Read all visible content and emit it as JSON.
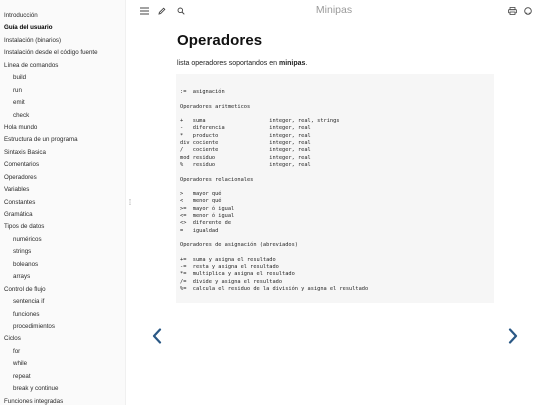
{
  "sidebar": {
    "items": [
      {
        "label": "Introducción",
        "level": 1,
        "active": false
      },
      {
        "label": "Guía del usuario",
        "level": 1,
        "active": true
      },
      {
        "label": "Instalación (binarios)",
        "level": 1,
        "active": false
      },
      {
        "label": "Instalación desde el código fuente",
        "level": 1,
        "active": false
      },
      {
        "label": "Línea de comandos",
        "level": 1,
        "active": false
      },
      {
        "label": "build",
        "level": 2,
        "active": false
      },
      {
        "label": "run",
        "level": 2,
        "active": false
      },
      {
        "label": "emit",
        "level": 2,
        "active": false
      },
      {
        "label": "check",
        "level": 2,
        "active": false
      },
      {
        "label": "Hola mundo",
        "level": 1,
        "active": false
      },
      {
        "label": "Estructura de un programa",
        "level": 1,
        "active": false
      },
      {
        "label": "Sintaxis Basica",
        "level": 1,
        "active": false
      },
      {
        "label": "Comentarios",
        "level": 1,
        "active": false
      },
      {
        "label": "Operadores",
        "level": 1,
        "active": false
      },
      {
        "label": "Variables",
        "level": 1,
        "active": false
      },
      {
        "label": "Constantes",
        "level": 1,
        "active": false
      },
      {
        "label": "Gramática",
        "level": 1,
        "active": false
      },
      {
        "label": "Tipos de datos",
        "level": 1,
        "active": false
      },
      {
        "label": "numéricos",
        "level": 2,
        "active": false
      },
      {
        "label": "strings",
        "level": 2,
        "active": false
      },
      {
        "label": "boleanos",
        "level": 2,
        "active": false
      },
      {
        "label": "arrays",
        "level": 2,
        "active": false
      },
      {
        "label": "Control de flujo",
        "level": 1,
        "active": false
      },
      {
        "label": "sentencia if",
        "level": 2,
        "active": false
      },
      {
        "label": "funciones",
        "level": 2,
        "active": false
      },
      {
        "label": "procedimientos",
        "level": 2,
        "active": false
      },
      {
        "label": "Ciclos",
        "level": 1,
        "active": false
      },
      {
        "label": "for",
        "level": 2,
        "active": false
      },
      {
        "label": "while",
        "level": 2,
        "active": false
      },
      {
        "label": "repeat",
        "level": 2,
        "active": false
      },
      {
        "label": "break y continue",
        "level": 2,
        "active": false
      },
      {
        "label": "Funciones integradas",
        "level": 1,
        "active": false
      }
    ]
  },
  "topbar": {
    "title": "Minipas",
    "icons": [
      "menu-icon",
      "pencil-icon",
      "search-icon",
      "print-icon",
      "github-icon"
    ]
  },
  "page": {
    "heading": "Operadores",
    "intro_prefix": "lista operadores soportandos en ",
    "intro_bold": "minipas",
    "intro_suffix": "."
  },
  "code": {
    "lines": [
      ":=  asignación",
      "",
      "Operadores aritmeticos",
      "",
      "+   suma                    integer, real, strings",
      "-   diferencia              integer, real",
      "*   producto                integer, real",
      "div cociente                integer, real",
      "/   cociente                integer, real",
      "mod residuo                 integer, real",
      "%   residuo                 integer, real",
      "",
      "Operadores relacionales",
      "",
      ">   mayor qué",
      "<   menor qué",
      ">=  mayor ó igual",
      "<=  menor ó igual",
      "<>  diferente de",
      "=   igualdad",
      "",
      "Operadores de asignación (abreviados)",
      "",
      "+=  suma y asigna el resultado",
      "-=  resta y asigna el resultado",
      "*=  multiplica y asigna el resultado",
      "/=  divide y asigna el resultado",
      "%=  calcula el residuo de la división y asigna el resultado"
    ]
  },
  "nav": {
    "prev_icon": "chevron-left-icon",
    "next_icon": "chevron-right-icon"
  }
}
